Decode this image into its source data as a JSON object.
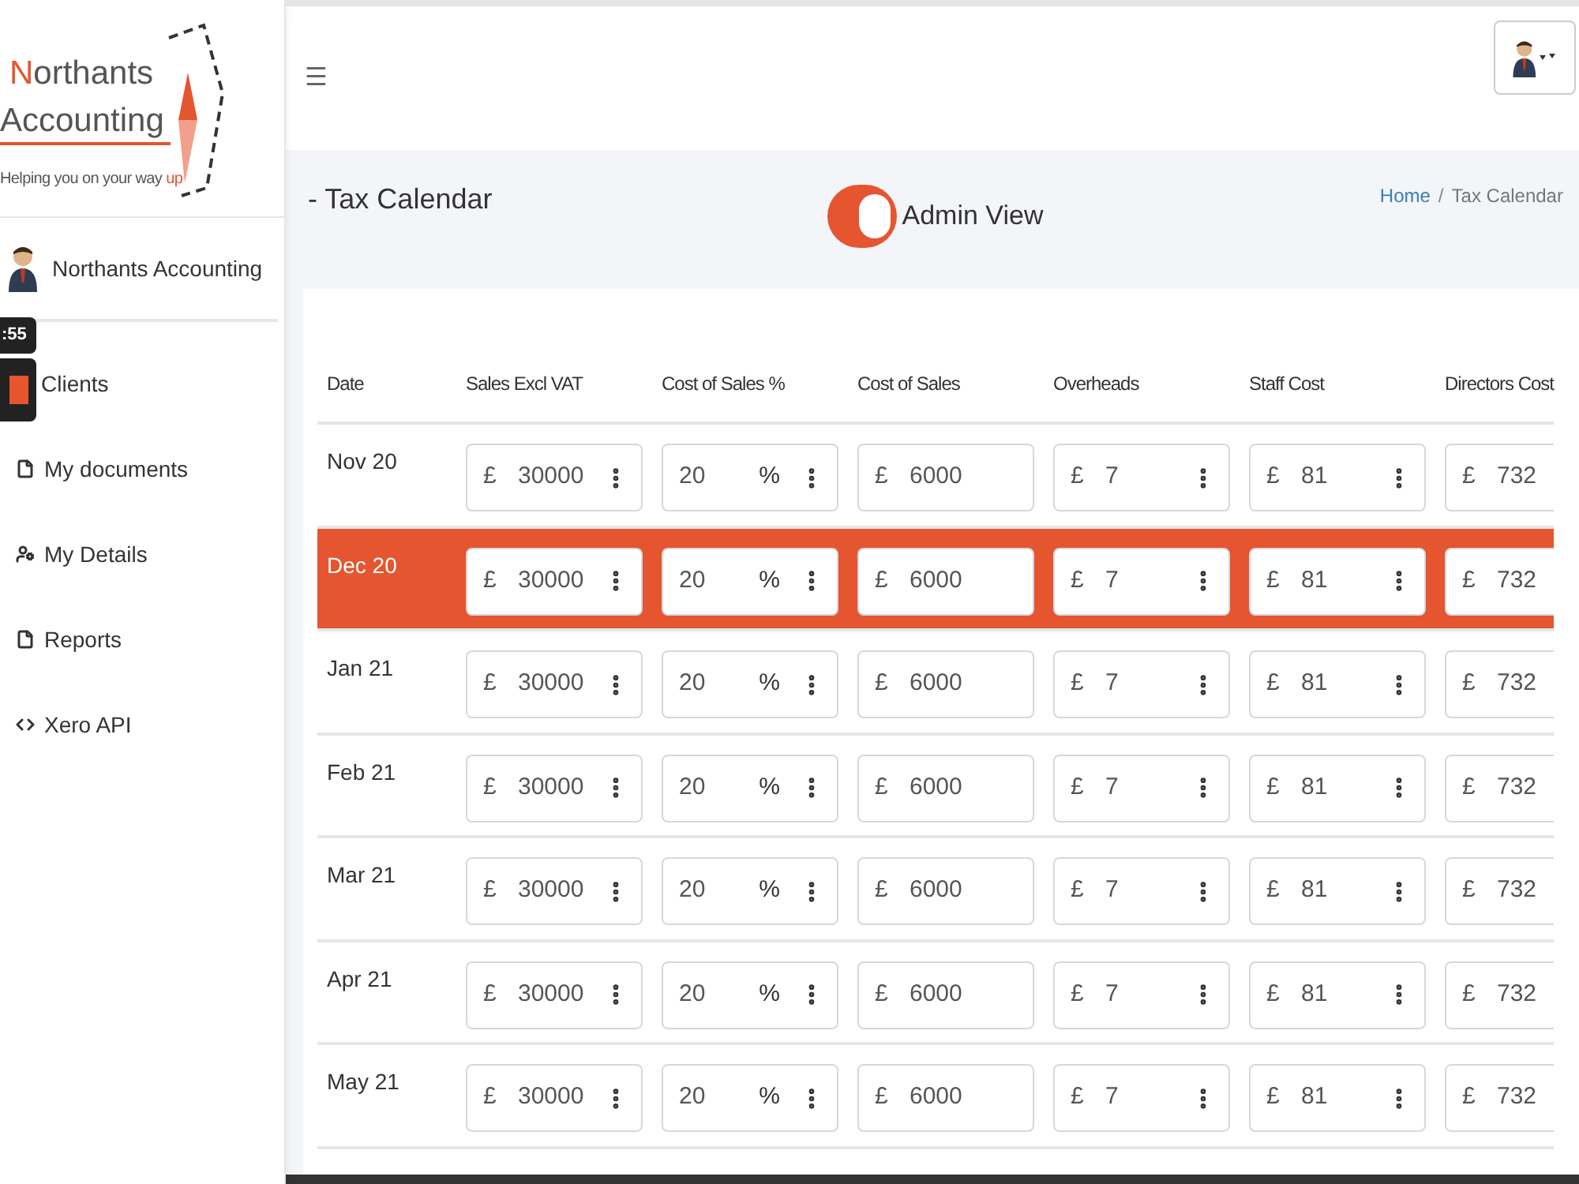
{
  "logo": {
    "initial": "N",
    "rest": "orthants",
    "line2": "Accounting",
    "tagline": "Helping you on your way",
    "tagline_accent": "up"
  },
  "profile": {
    "name": "Northants Accounting"
  },
  "recorder": {
    "time": ":55"
  },
  "sidebar": {
    "items": [
      {
        "label": "Clients",
        "kind": "none"
      },
      {
        "label": "My documents",
        "kind": "file"
      },
      {
        "label": "My Details",
        "kind": "user-cog"
      },
      {
        "label": "Reports",
        "kind": "file"
      },
      {
        "label": "Xero API",
        "kind": "code"
      }
    ]
  },
  "header": {
    "menu_glyph": "☰"
  },
  "page": {
    "title": "- Tax Calendar",
    "admin_toggle": {
      "label": "Admin View",
      "on": true
    },
    "breadcrumb": [
      {
        "label": "Home",
        "kind": "link"
      },
      {
        "label": "/",
        "kind": "separator"
      },
      {
        "label": "Tax Calendar",
        "kind": "current"
      }
    ]
  },
  "table": {
    "columns": [
      "Date",
      "Sales Excl VAT",
      "Cost of Sales %",
      "Cost of Sales",
      "Overheads",
      "Staff Cost",
      "Directors Cost"
    ],
    "rows": [
      {
        "selected": false,
        "cells": [
          {
            "kind": "date",
            "value": "Nov 20"
          },
          {
            "kind": "menu",
            "prefix": "£",
            "value": "30000"
          },
          {
            "kind": "menu",
            "value": "20",
            "suffix": "%"
          },
          {
            "kind": "plain",
            "prefix": "£",
            "value": "6000"
          },
          {
            "kind": "menu",
            "prefix": "£",
            "value": "7"
          },
          {
            "kind": "menu",
            "prefix": "£",
            "value": "81"
          },
          {
            "kind": "plain",
            "prefix": "£",
            "value": "732"
          }
        ]
      },
      {
        "selected": true,
        "cells": [
          {
            "kind": "date",
            "value": "Dec 20"
          },
          {
            "kind": "menu",
            "prefix": "£",
            "value": "30000"
          },
          {
            "kind": "menu",
            "value": "20",
            "suffix": "%"
          },
          {
            "kind": "plain",
            "prefix": "£",
            "value": "6000"
          },
          {
            "kind": "menu",
            "prefix": "£",
            "value": "7"
          },
          {
            "kind": "menu",
            "prefix": "£",
            "value": "81"
          },
          {
            "kind": "plain",
            "prefix": "£",
            "value": "732"
          }
        ]
      },
      {
        "selected": false,
        "cells": [
          {
            "kind": "date",
            "value": "Jan 21"
          },
          {
            "kind": "menu",
            "prefix": "£",
            "value": "30000"
          },
          {
            "kind": "menu",
            "value": "20",
            "suffix": "%"
          },
          {
            "kind": "plain",
            "prefix": "£",
            "value": "6000"
          },
          {
            "kind": "menu",
            "prefix": "£",
            "value": "7"
          },
          {
            "kind": "menu",
            "prefix": "£",
            "value": "81"
          },
          {
            "kind": "plain",
            "prefix": "£",
            "value": "732"
          }
        ]
      },
      {
        "selected": false,
        "cells": [
          {
            "kind": "date",
            "value": "Feb 21"
          },
          {
            "kind": "menu",
            "prefix": "£",
            "value": "30000"
          },
          {
            "kind": "menu",
            "value": "20",
            "suffix": "%"
          },
          {
            "kind": "plain",
            "prefix": "£",
            "value": "6000"
          },
          {
            "kind": "menu",
            "prefix": "£",
            "value": "7"
          },
          {
            "kind": "menu",
            "prefix": "£",
            "value": "81"
          },
          {
            "kind": "plain",
            "prefix": "£",
            "value": "732"
          }
        ]
      },
      {
        "selected": false,
        "cells": [
          {
            "kind": "date",
            "value": "Mar 21"
          },
          {
            "kind": "menu",
            "prefix": "£",
            "value": "30000"
          },
          {
            "kind": "menu",
            "value": "20",
            "suffix": "%"
          },
          {
            "kind": "plain",
            "prefix": "£",
            "value": "6000"
          },
          {
            "kind": "menu",
            "prefix": "£",
            "value": "7"
          },
          {
            "kind": "menu",
            "prefix": "£",
            "value": "81"
          },
          {
            "kind": "plain",
            "prefix": "£",
            "value": "732"
          }
        ]
      },
      {
        "selected": false,
        "cells": [
          {
            "kind": "date",
            "value": "Apr 21"
          },
          {
            "kind": "menu",
            "prefix": "£",
            "value": "30000"
          },
          {
            "kind": "menu",
            "value": "20",
            "suffix": "%"
          },
          {
            "kind": "plain",
            "prefix": "£",
            "value": "6000"
          },
          {
            "kind": "menu",
            "prefix": "£",
            "value": "7"
          },
          {
            "kind": "menu",
            "prefix": "£",
            "value": "81"
          },
          {
            "kind": "plain",
            "prefix": "£",
            "value": "732"
          }
        ]
      },
      {
        "selected": false,
        "cells": [
          {
            "kind": "date",
            "value": "May 21"
          },
          {
            "kind": "menu",
            "prefix": "£",
            "value": "30000"
          },
          {
            "kind": "menu",
            "value": "20",
            "suffix": "%"
          },
          {
            "kind": "plain",
            "prefix": "£",
            "value": "6000"
          },
          {
            "kind": "menu",
            "prefix": "£",
            "value": "7"
          },
          {
            "kind": "menu",
            "prefix": "£",
            "value": "81"
          },
          {
            "kind": "plain",
            "prefix": "£",
            "value": "732"
          }
        ]
      }
    ]
  }
}
